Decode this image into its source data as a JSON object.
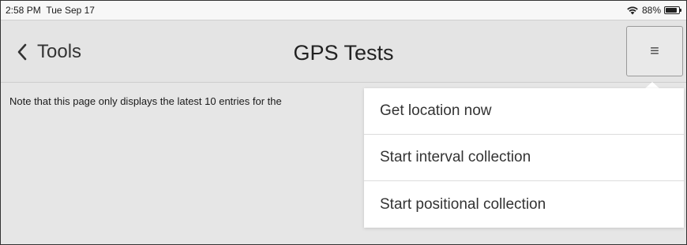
{
  "status_bar": {
    "time": "2:58 PM",
    "date": "Tue Sep 17",
    "battery": "88%",
    "battery_level": 0.88,
    "wifi_icon": "wifi-icon",
    "battery_icon": "battery-icon"
  },
  "nav": {
    "back_label": "Tools",
    "back_icon": "chevron-left-icon",
    "title": "GPS Tests",
    "menu_icon": "hamburger-icon",
    "menu_glyph": "≡"
  },
  "content": {
    "note": "Note that this page only displays the latest 10 entries for the"
  },
  "menu": {
    "items": [
      {
        "label": "Get location now"
      },
      {
        "label": "Start interval collection"
      },
      {
        "label": "Start positional collection"
      }
    ]
  }
}
